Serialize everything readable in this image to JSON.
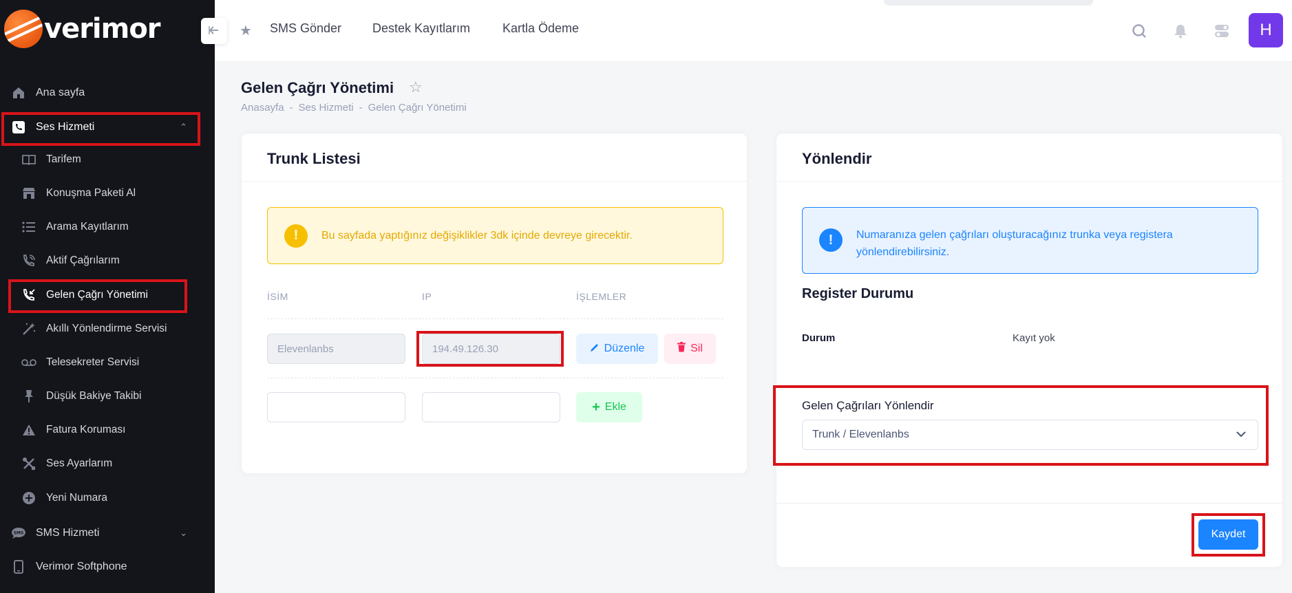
{
  "brand": {
    "logo_text": "verimor"
  },
  "sidebar": {
    "items": [
      {
        "label": "Ana sayfa"
      },
      {
        "label": "Ses Hizmeti"
      },
      {
        "label": "Tarifem"
      },
      {
        "label": "Konuşma Paketi Al"
      },
      {
        "label": "Arama Kayıtlarım"
      },
      {
        "label": "Aktif Çağrılarım"
      },
      {
        "label": "Gelen Çağrı Yönetimi"
      },
      {
        "label": "Akıllı Yönlendirme Servisi"
      },
      {
        "label": "Telesekreter Servisi"
      },
      {
        "label": "Düşük Bakiye Takibi"
      },
      {
        "label": "Fatura Koruması"
      },
      {
        "label": "Ses Ayarlarım"
      },
      {
        "label": "Yeni Numara"
      },
      {
        "label": "SMS Hizmeti"
      },
      {
        "label": "Verimor Softphone"
      }
    ]
  },
  "header": {
    "links": [
      "SMS Gönder",
      "Destek Kayıtlarım",
      "Kartla Ödeme"
    ],
    "avatar_initial": "H"
  },
  "page": {
    "title": "Gelen Çağrı Yönetimi",
    "breadcrumb": [
      "Anasayfa",
      "Ses Hizmeti",
      "Gelen Çağrı Yönetimi"
    ]
  },
  "trunk_card": {
    "title": "Trunk Listesi",
    "warning": "Bu sayfada yaptığınız değişiklikler 3dk içinde devreye girecektir.",
    "columns": [
      "İSİM",
      "IP",
      "İŞLEMLER"
    ],
    "rows": [
      {
        "name": "Elevenlanbs",
        "ip": "194.49.126.30",
        "edit_label": "Düzenle",
        "delete_label": "Sil"
      }
    ],
    "new_row": {
      "name": "",
      "ip": "",
      "add_label": "Ekle"
    }
  },
  "redirect_card": {
    "title": "Yönlendir",
    "info": "Numaranıza gelen çağrıları oluşturacağınız trunka veya registera yönlendirebilirsiniz.",
    "register_title": "Register Durumu",
    "status_key": "Durum",
    "status_value": "Kayıt yok",
    "select_label": "Gelen Çağrıları Yönlendir",
    "select_value": "Trunk / Elevenlanbs",
    "save_label": "Kaydet"
  },
  "colors": {
    "sidebar_bg": "#13151a",
    "primary": "#1b84ff",
    "avatar": "#7239ea",
    "highlight": "#d8141a",
    "warning": "#f6c000"
  }
}
